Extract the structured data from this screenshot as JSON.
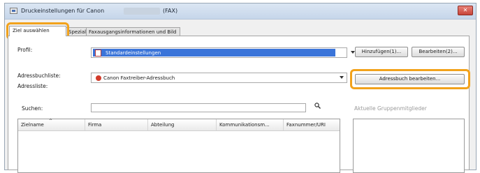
{
  "window": {
    "title": "Druckeinstellungen für Canon",
    "title_suffix": "(FAX)",
    "close_label": "✕"
  },
  "tabs": [
    {
      "label": "Ziel auswählen",
      "active": true
    },
    {
      "label": "Spezial",
      "active": false
    },
    {
      "label": "Faxausgangsinformationen und Bild",
      "active": false
    }
  ],
  "profile": {
    "label": "Profil:",
    "value": "Standardeinstellungen",
    "add_button": "Hinzufügen(1)...",
    "edit_button": "Bearbeiten(2)..."
  },
  "address_book": {
    "label": "Adressbuchliste:",
    "value": "Canon Faxtreiber-Adressbuch",
    "edit_button": "Adressbuch bearbeiten..."
  },
  "address_list": {
    "label": "Adressliste:",
    "search_label": "Suchen:",
    "search_value": "",
    "columns": [
      "Zielname",
      "Firma",
      "Abteilung",
      "Kommunikationsm...",
      "Faxnummer/URI"
    ]
  },
  "group_members_label": "Aktuelle Gruppenmitglieder",
  "colors": {
    "callout": "#f2a21b",
    "selection": "#3a74d9"
  }
}
